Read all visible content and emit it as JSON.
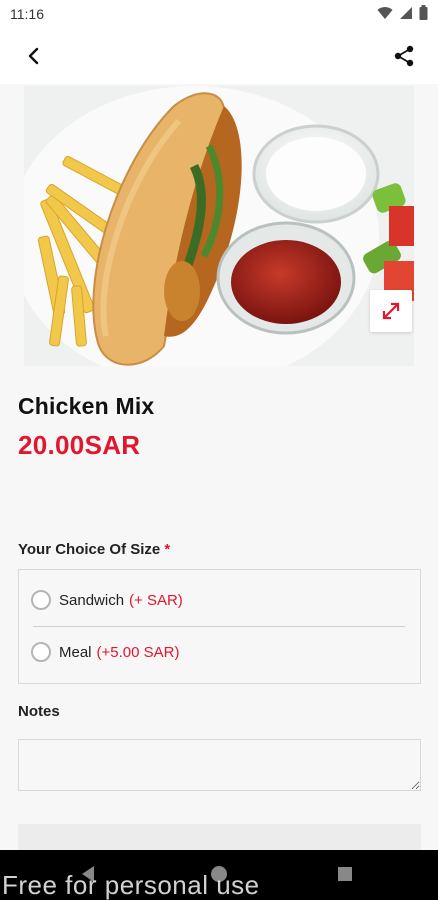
{
  "status_bar": {
    "time": "11:16"
  },
  "product": {
    "name": "Chicken Mix",
    "price": "20.00SAR"
  },
  "size_choice": {
    "label": "Your Choice Of Size",
    "required_marker": "*",
    "options": [
      {
        "name": "Sandwich",
        "extra": "(+ SAR)"
      },
      {
        "name": "Meal",
        "extra": "(+5.00 SAR)"
      }
    ]
  },
  "notes": {
    "label": "Notes",
    "value": ""
  },
  "watermark": "Free for personal use",
  "colors": {
    "accent": "#e0172d",
    "text": "#111111",
    "background": "#f7f7f7"
  },
  "icons": [
    "wifi-icon",
    "signal-icon",
    "battery-icon",
    "back-arrow-icon",
    "share-icon",
    "expand-icon",
    "nav-back-icon",
    "nav-home-icon",
    "nav-recent-icon"
  ]
}
